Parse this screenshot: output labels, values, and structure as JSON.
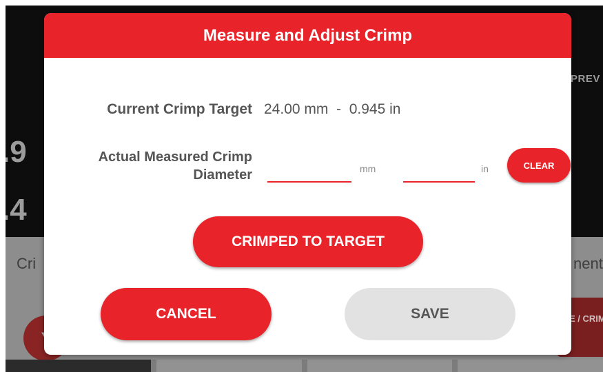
{
  "background": {
    "prev_label": "PREV",
    "value_1": ".9",
    "value_2": ".4",
    "left_text": "Cri",
    "right_text": "nent",
    "circle_text": "Y",
    "side_button_label": "E / CRIM"
  },
  "dialog": {
    "title": "Measure and Adjust Crimp",
    "current_target_label": "Current Crimp Target",
    "current_target_value": "24.00 mm  -  0.945 in",
    "measured_label": "Actual Measured Crimp Diameter",
    "measured_mm_value": "",
    "measured_in_value": "",
    "unit_mm": "mm",
    "unit_in": "in",
    "clear_label": "CLEAR",
    "crimped_label": "CRIMPED TO TARGET",
    "cancel_label": "CANCEL",
    "save_label": "SAVE"
  },
  "colors": {
    "accent": "#e8232a",
    "save_bg": "#e2e2e2",
    "text": "#555555"
  }
}
